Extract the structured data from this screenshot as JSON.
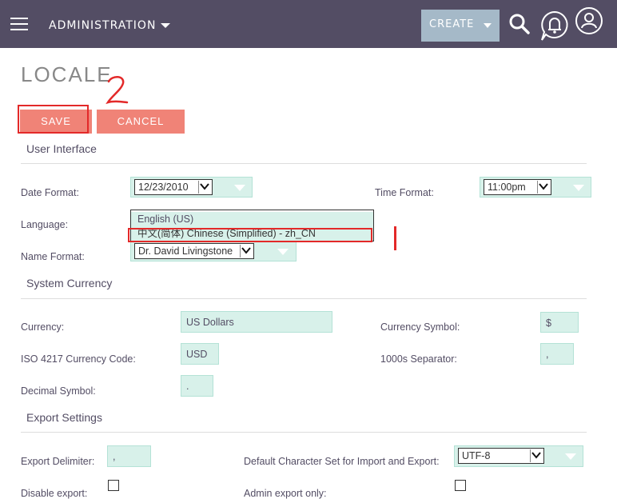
{
  "header": {
    "menu_label": "ADMINISTRATION",
    "create_label": "CREATE"
  },
  "page": {
    "title": "LOCALE"
  },
  "annotations": {
    "step2": "2"
  },
  "actions": {
    "save_label": "SAVE",
    "cancel_label": "CANCEL"
  },
  "user_interface": {
    "section_title": "User Interface",
    "date_format_label": "Date Format:",
    "date_format_value": "12/23/2010",
    "time_format_label": "Time Format:",
    "time_format_value": "11:00pm",
    "language_label": "Language:",
    "language_options": [
      "English (US)",
      "中文(简体) Chinese (Simplified) - zh_CN"
    ],
    "name_format_label": "Name Format:",
    "name_format_value": "Dr. David Livingstone"
  },
  "system_currency": {
    "section_title": "System Currency",
    "currency_label": "Currency:",
    "currency_value": "US Dollars",
    "currency_symbol_label": "Currency Symbol:",
    "currency_symbol_value": "$",
    "iso_label": "ISO 4217 Currency Code:",
    "iso_value": "USD",
    "thousands_label": "1000s Separator:",
    "thousands_value": ",",
    "decimal_label": "Decimal Symbol:",
    "decimal_value": "."
  },
  "export_settings": {
    "section_title": "Export Settings",
    "delimiter_label": "Export Delimiter:",
    "delimiter_value": ",",
    "charset_label": "Default Character Set for Import and Export:",
    "charset_value": "UTF-8",
    "disable_export_label": "Disable export:",
    "admin_export_label": "Admin export only:"
  },
  "colors": {
    "header_bg": "#534d64",
    "accent_button": "#f08377",
    "field_bg": "#d8f1ea",
    "annotation_red": "#e32929"
  }
}
